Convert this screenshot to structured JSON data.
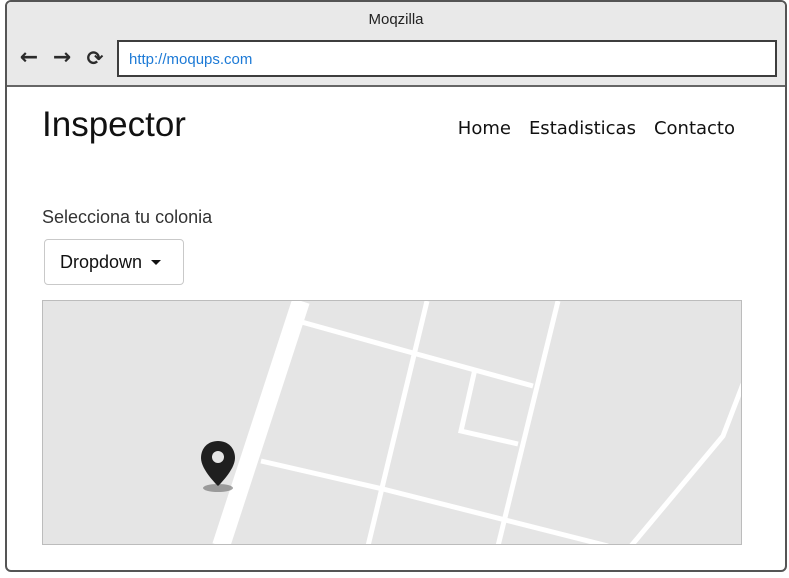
{
  "browser": {
    "title": "Moqzilla",
    "url": "http://moqups.com",
    "back_icon": "left-arrow",
    "forward_icon": "right-arrow",
    "reload_icon": "reload"
  },
  "page": {
    "brand": "Inspector",
    "nav": [
      "Home",
      "Estadisticas",
      "Contacto"
    ],
    "colony_label": "Selecciona tu colonia",
    "dropdown_label": "Dropdown",
    "map_marker_icon": "map-pin"
  },
  "colors": {
    "url_text": "#1d7ad6",
    "map_background": "#e5e5e5",
    "map_roads": "#ffffff",
    "marker": "#1f1f1f"
  }
}
